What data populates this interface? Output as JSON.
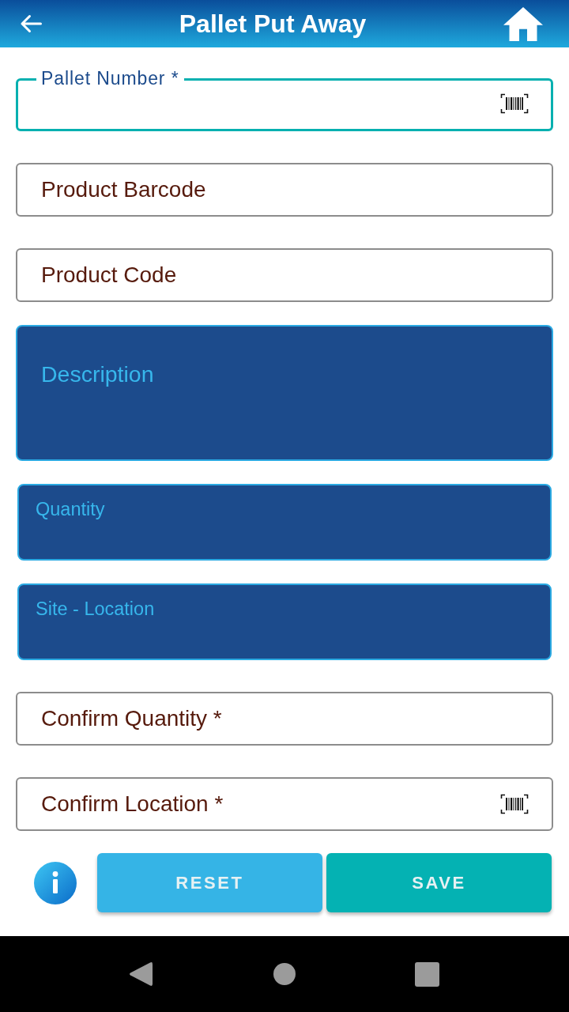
{
  "app_bar": {
    "title": "Pallet Put Away"
  },
  "fields": [
    {
      "kind": "outlined",
      "label": "Pallet Number *",
      "focused": true,
      "disabled": false,
      "scannable": true
    },
    {
      "kind": "text",
      "placeholder": "Product Barcode",
      "focused": false,
      "disabled": false,
      "scannable": false
    },
    {
      "kind": "text",
      "placeholder": "Product Code",
      "focused": false,
      "disabled": false,
      "scannable": false
    },
    {
      "kind": "textarea",
      "placeholder": "Description",
      "focused": false,
      "disabled": true,
      "scannable": false
    },
    {
      "kind": "compact",
      "placeholder": "Quantity",
      "focused": false,
      "disabled": true,
      "scannable": false
    },
    {
      "kind": "compact",
      "placeholder": "Site - Location",
      "focused": false,
      "disabled": true,
      "scannable": false
    },
    {
      "kind": "text",
      "placeholder": "Confirm Quantity *",
      "focused": false,
      "disabled": false,
      "scannable": false
    },
    {
      "kind": "text",
      "placeholder": "Confirm Location *",
      "focused": false,
      "disabled": false,
      "scannable": true
    }
  ],
  "buttons": [
    {
      "kind": "secondary",
      "label": "RESET"
    },
    {
      "kind": "primary",
      "label": "SAVE"
    }
  ]
}
